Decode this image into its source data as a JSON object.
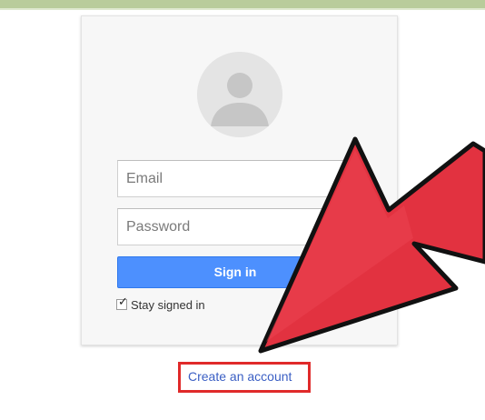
{
  "login": {
    "email_placeholder": "Email",
    "password_placeholder": "Password",
    "signin_label": "Sign in",
    "stay_signed_in_label": "Stay signed in",
    "stay_signed_in_checked": true
  },
  "create_account_label": "Create an account",
  "icons": {
    "avatar": "default-user-avatar-icon",
    "arrow": "red-pointer-arrow-icon",
    "check": "checkmark-icon"
  },
  "colors": {
    "signin_button": "#4d90fe",
    "link": "#3b5fc4",
    "highlight": "#e02a2a",
    "arrow_fill": "#e23240",
    "top_strip": "#b9cc9b"
  }
}
